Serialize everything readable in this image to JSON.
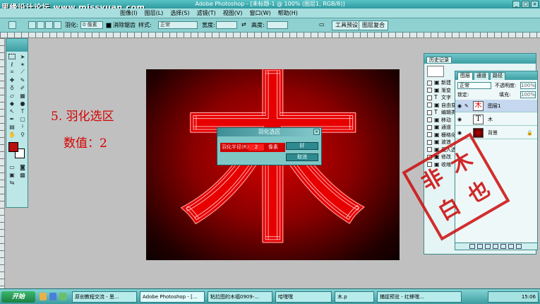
{
  "watermark": "思缘设计论坛 www.missyuan.com",
  "window": {
    "title": "Adobe Photoshop - [未标题-1 @ 100% (图层1, RGB/8)]",
    "minimize_symbol": "_",
    "maximize_symbol": "□",
    "close_symbol": "×"
  },
  "menu": {
    "items": [
      "图像(I)",
      "图层(L)",
      "选择(S)",
      "滤镜(T)",
      "视图(V)",
      "窗口(W)",
      "帮助(H)"
    ]
  },
  "options": {
    "feather_label": "羽化:",
    "feather_value": "0 像素",
    "antialias_label": "消除锯齿",
    "style_label": "样式:",
    "style_value": "正常",
    "width_label": "宽度:",
    "height_label": "高度:",
    "toolbox_tab": "工具预设",
    "layer_comps_tab": "图层复合"
  },
  "annotations": {
    "step": "5. 羽化选区",
    "value_text": "数值：2"
  },
  "canvas": {
    "character": "木"
  },
  "dialog": {
    "title": "羽化选区",
    "close_symbol": "×",
    "field_label": "羽化半径(R):",
    "field_value": "2",
    "unit": "像素",
    "ok_label": "好",
    "cancel_label": "取消"
  },
  "history": {
    "tab_label": "历史记录",
    "items": [
      {
        "icon": "▣",
        "label": "新建"
      },
      {
        "icon": "▣",
        "label": "渐变"
      },
      {
        "icon": "T",
        "label": "文字"
      },
      {
        "icon": "▣",
        "label": "自由变换"
      },
      {
        "icon": "T",
        "label": "编辑类型"
      },
      {
        "icon": "▣",
        "label": "移动"
      },
      {
        "icon": "▣",
        "label": "通道"
      },
      {
        "icon": "▣",
        "label": "栅格化"
      },
      {
        "icon": "▣",
        "label": "波浪"
      },
      {
        "icon": "▣",
        "label": "载入选区"
      },
      {
        "icon": "▣",
        "label": "修改"
      },
      {
        "icon": "▣",
        "label": "收缩"
      }
    ]
  },
  "layers": {
    "tabs": [
      "图层",
      "通道",
      "路径"
    ],
    "blend_mode": "正常",
    "opacity_label": "不透明度:",
    "opacity_value": "100%",
    "lock_label": "锁定:",
    "fill_label": "填充:",
    "fill_value": "100%",
    "items": [
      {
        "name": "图层1",
        "thumb": "木",
        "active": true
      },
      {
        "name": "木",
        "thumb": "T",
        "active": false
      },
      {
        "name": "背景",
        "thumb": "",
        "active": false
      }
    ]
  },
  "stamp": {
    "chars": [
      "木",
      "非",
      "白",
      "也"
    ],
    "color": "#cd0a0a"
  },
  "colors": {
    "foreground": "#b50f0f",
    "background": "#ffffff",
    "theme": "#4aa9ad"
  },
  "taskbar": {
    "start_label": "开始",
    "tasks": [
      "原创教程交流 - 思...",
      "Adobe Photoshop - [...",
      "粘拉图的木福0909-...",
      "哈嘿嘿",
      "木.p",
      "捕捉预览 - 红蜂嘿..."
    ],
    "clock": "15:06"
  }
}
